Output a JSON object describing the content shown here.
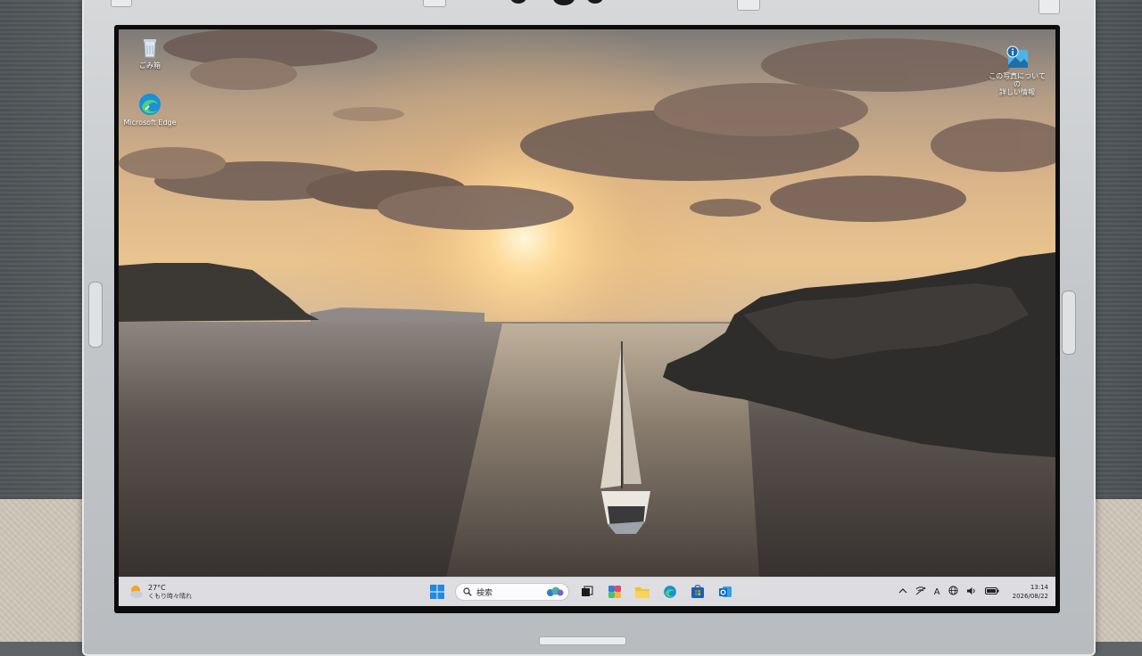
{
  "desktop_icons": [
    {
      "label": "ごみ箱",
      "icon": "recycle-bin-icon"
    },
    {
      "label": "Microsoft Edge",
      "icon": "edge-icon"
    },
    {
      "label_line1": "この写真についての",
      "label_line2": "詳しい情報",
      "icon": "spotlight-info-icon"
    }
  ],
  "taskbar": {
    "weather": {
      "temp": "27°C",
      "condition": "くもり時々晴れ",
      "icon": "partly-cloudy-icon"
    },
    "search_placeholder": "検索",
    "pinned_icons": [
      "windows-start-icon",
      "copilot-icon",
      "task-view-icon",
      "widgets-icon",
      "file-explorer-icon",
      "edge-icon",
      "microsoft-store-icon",
      "outlook-icon"
    ],
    "tray": {
      "icons": [
        "chevron-up-icon",
        "network-off-icon",
        "ime-icon",
        "globe-icon",
        "speaker-icon",
        "battery-icon"
      ],
      "ime_label": "A",
      "time": "13:14",
      "date": "2026/08/22"
    }
  }
}
